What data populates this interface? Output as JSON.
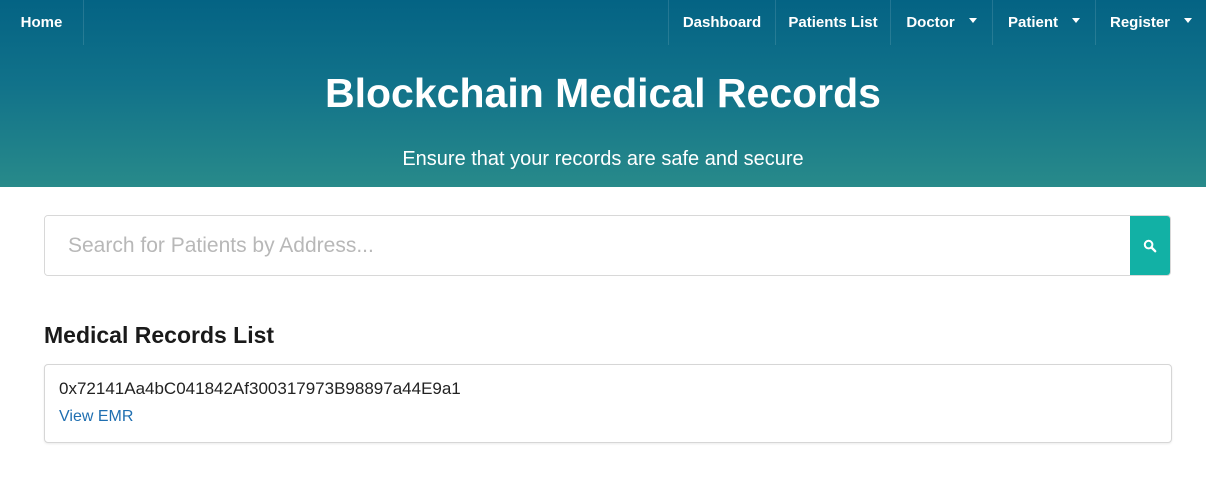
{
  "nav": {
    "home": "Home",
    "dashboard": "Dashboard",
    "patients_list": "Patients List",
    "doctor": "Doctor",
    "patient": "Patient",
    "register": "Register"
  },
  "hero": {
    "title": "Blockchain Medical Records",
    "subtitle": "Ensure that your records are safe and secure"
  },
  "search": {
    "placeholder": "Search for Patients by Address...",
    "value": "",
    "icon": "search-icon"
  },
  "records": {
    "heading": "Medical Records List",
    "items": [
      {
        "address": "0x72141Aa4bC041842Af300317973B98897a44E9a1",
        "link_label": "View EMR"
      }
    ]
  },
  "colors": {
    "header_top": "#046384",
    "header_bottom": "#288a8a",
    "search_button": "#12b1a5",
    "link": "#1f6fb1"
  }
}
